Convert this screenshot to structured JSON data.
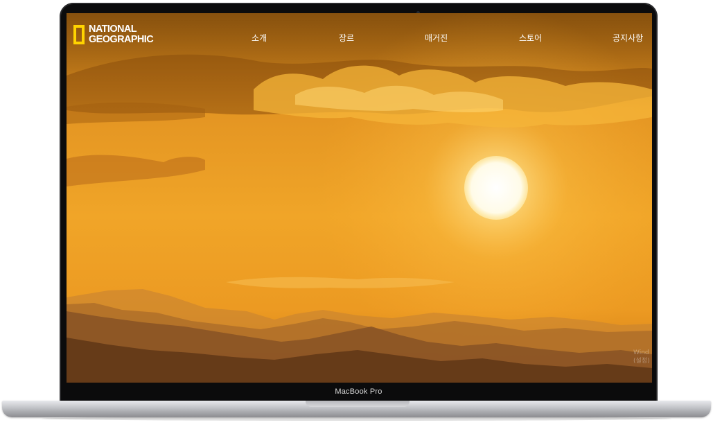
{
  "device": {
    "label": "MacBook Pro"
  },
  "site": {
    "logo": {
      "line1": "NATIONAL",
      "line2": "GEOGRAPHIC"
    },
    "nav": [
      {
        "label": "소개"
      },
      {
        "label": "장르"
      },
      {
        "label": "매거진"
      },
      {
        "label": "스토어"
      },
      {
        "label": "공지사항"
      }
    ],
    "hero": {
      "description": "sunset-over-mountains"
    },
    "watermark": {
      "line1": "Wind",
      "line2": "(설정)"
    }
  },
  "colors": {
    "logo_yellow": "#ffd400",
    "sky": "#e6921f",
    "nav_text": "#ffffff"
  }
}
